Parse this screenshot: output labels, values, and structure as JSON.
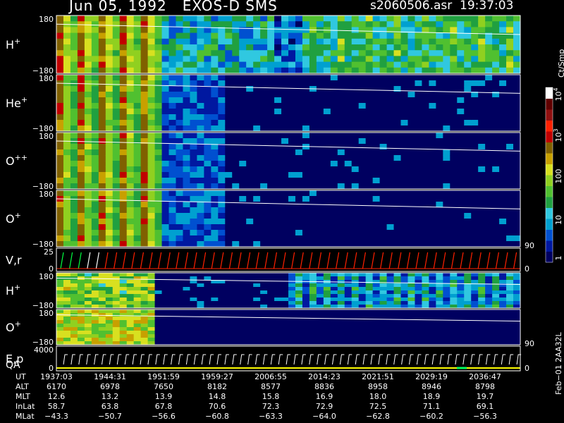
{
  "title": {
    "left": "Jun 05, 1992   EXOS-D SMS",
    "right": "s2060506.asr  19:37:03"
  },
  "colorbar": {
    "label": "Ct/Smp",
    "ticks": [
      "1",
      "10",
      "100",
      "10",
      "10"
    ],
    "tick_exponents": [
      "",
      "",
      "",
      "3",
      "4"
    ],
    "colors": [
      "#000060",
      "#0018a0",
      "#0050d0",
      "#00a0d0",
      "#30c8e0",
      "#20a040",
      "#50c030",
      "#90d020",
      "#d8e020",
      "#c8a000",
      "#806000",
      "#c00000",
      "#ff2000",
      "#901010",
      "#600000",
      "#ffffff"
    ]
  },
  "panels": [
    {
      "label": "H",
      "sup": "+",
      "top": "180",
      "bottom": "−180"
    },
    {
      "label": "He",
      "sup": "+",
      "top": "180",
      "bottom": "−180"
    },
    {
      "label": "O",
      "sup": "++",
      "top": "180",
      "bottom": "−180"
    },
    {
      "label": "O",
      "sup": "+",
      "top": "180",
      "bottom": "−180",
      "right_tick": "90"
    },
    {
      "label": "V,r",
      "sup": "",
      "top": "25",
      "bottom": "0",
      "right_tick": "0"
    },
    {
      "label": "H",
      "sup": "+",
      "top": "180",
      "bottom": "−180"
    },
    {
      "label": "O",
      "sup": "+",
      "top": "180",
      "bottom": "−180",
      "right_tick": "90"
    },
    {
      "label": "E,p",
      "sup": "",
      "top": "4000",
      "bottom": "0",
      "right_tick": "0"
    }
  ],
  "qa_label": "QA",
  "footer": {
    "rows": [
      {
        "label": "UT",
        "values": [
          "1937:03",
          "1944:31",
          "1951:59",
          "1959:27",
          "2006:55",
          "2014:23",
          "2021:51",
          "2029:19",
          "2036:47"
        ]
      },
      {
        "label": "ALT",
        "values": [
          "6170",
          "6978",
          "7650",
          "8182",
          "8577",
          "8836",
          "8958",
          "8946",
          "8798"
        ]
      },
      {
        "label": "MLT",
        "values": [
          "12.6",
          "13.2",
          "13.9",
          "14.8",
          "15.8",
          "16.9",
          "18.0",
          "18.9",
          "19.7"
        ]
      },
      {
        "label": "InLat",
        "values": [
          "58.7",
          "63.8",
          "67.8",
          "70.6",
          "72.3",
          "72.9",
          "72.5",
          "71.1",
          "69.1"
        ]
      },
      {
        "label": "MLat",
        "values": [
          "−43.3",
          "−50.7",
          "−56.6",
          "−60.8",
          "−63.3",
          "−64.0",
          "−62.8",
          "−60.2",
          "−56.3"
        ]
      }
    ],
    "side_id": "Feb−01 2AA32L"
  },
  "chart_data": {
    "type": "heatmap",
    "title": "Jun 05, 1992   EXOS-D SMS",
    "x": [
      "1937:03",
      "1944:31",
      "1951:59",
      "1959:27",
      "2006:55",
      "2014:23",
      "2021:51",
      "2029:19",
      "2036:47"
    ],
    "xlabel": "UT",
    "ylim": [
      -180,
      180
    ],
    "series": [
      {
        "name": "H+"
      },
      {
        "name": "He+"
      },
      {
        "name": "O++"
      },
      {
        "name": "O+"
      },
      {
        "name": "V,r"
      },
      {
        "name": "H+"
      },
      {
        "name": "O+"
      },
      {
        "name": "E,p"
      }
    ],
    "colorbar_label": "Ct/Smp"
  }
}
